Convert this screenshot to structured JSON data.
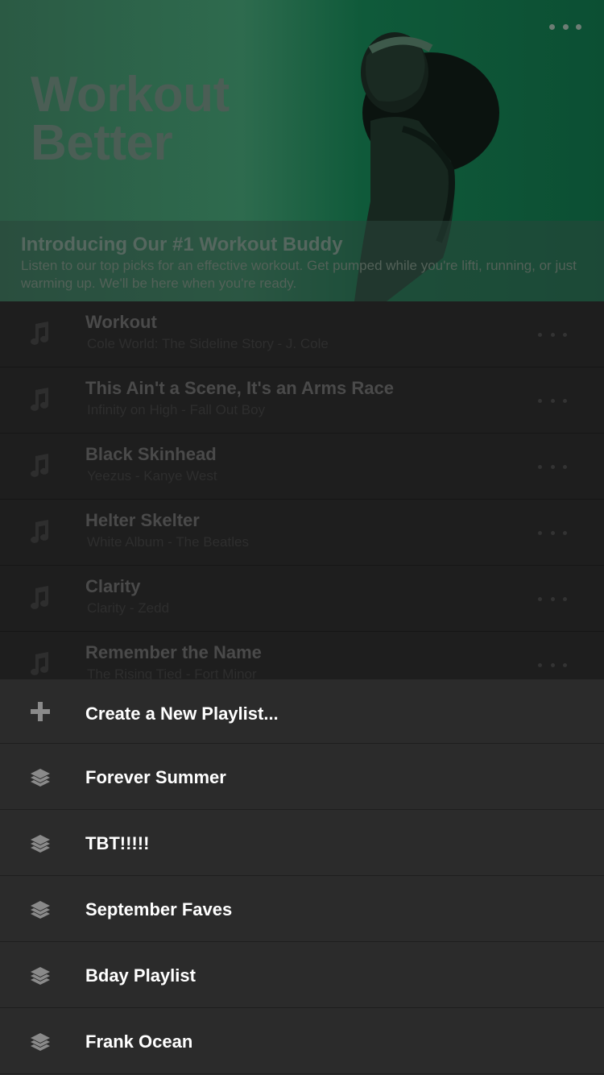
{
  "hero": {
    "title_line1": "Workout",
    "title_line2": "Better",
    "headline": "Introducing Our #1 Workout Buddy",
    "description": "Listen to our top picks for an effective workout. Get pumped while you're lifti, running, or just warming up. We'll be here when you're ready.",
    "more_icon": "more-horizontal-icon",
    "accent_color": "#0f5a3a"
  },
  "tracks": [
    {
      "title": "Workout",
      "subtitle": "Cole World: The Sideline Story - J. Cole",
      "icon": "music-note-icon"
    },
    {
      "title": "This Ain't a Scene, It's an Arms Race",
      "subtitle": "Infinity on High - Fall Out Boy",
      "icon": "music-note-icon"
    },
    {
      "title": "Black Skinhead",
      "subtitle": "Yeezus - Kanye West",
      "icon": "music-note-icon"
    },
    {
      "title": "Helter Skelter",
      "subtitle": "White Album - The Beatles",
      "icon": "music-note-icon"
    },
    {
      "title": "Clarity",
      "subtitle": "Clarity - Zedd",
      "icon": "music-note-icon"
    },
    {
      "title": "Remember the Name",
      "subtitle": "The Rising Tied - Fort Minor",
      "icon": "music-note-icon"
    }
  ],
  "sheet": {
    "create_label": "Create a New Playlist...",
    "create_icon": "plus-icon",
    "playlists": [
      {
        "label": "Forever Summer",
        "icon": "layers-icon"
      },
      {
        "label": "TBT!!!!!",
        "icon": "layers-icon"
      },
      {
        "label": "September Faves",
        "icon": "layers-icon"
      },
      {
        "label": "Bday Playlist",
        "icon": "layers-icon"
      },
      {
        "label": "Frank Ocean",
        "icon": "layers-icon"
      }
    ]
  }
}
